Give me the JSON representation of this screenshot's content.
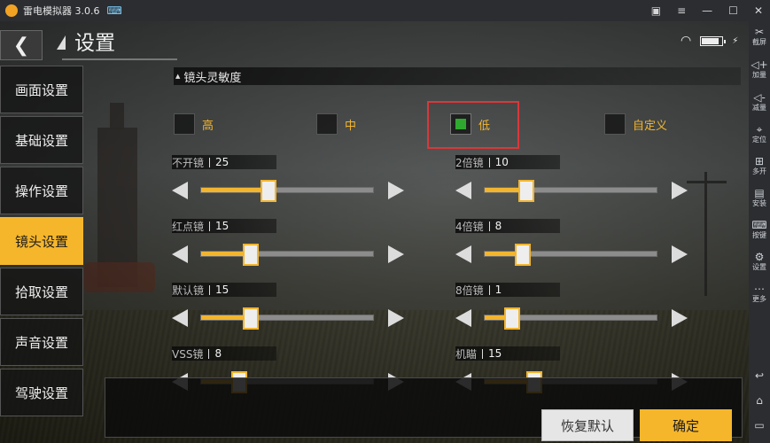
{
  "window": {
    "title": "雷电模拟器 3.0.6"
  },
  "sidebar": {
    "items": [
      {
        "label": "截屏",
        "icon": "scissors-icon"
      },
      {
        "label": "加量",
        "icon": "volume-up-icon"
      },
      {
        "label": "减量",
        "icon": "volume-down-icon"
      },
      {
        "label": "定位",
        "icon": "location-icon"
      },
      {
        "label": "多开",
        "icon": "multi-window-icon"
      },
      {
        "label": "安装",
        "icon": "apk-install-icon"
      },
      {
        "label": "按键",
        "icon": "keyboard-icon"
      },
      {
        "label": "设置",
        "icon": "gear-icon"
      },
      {
        "label": "更多",
        "icon": "more-icon"
      }
    ]
  },
  "header": {
    "title": "设置"
  },
  "status": {
    "battery_level": 0.85
  },
  "tabs": [
    {
      "label": "画面设置",
      "active": false
    },
    {
      "label": "基础设置",
      "active": false
    },
    {
      "label": "操作设置",
      "active": false
    },
    {
      "label": "镜头设置",
      "active": true
    },
    {
      "label": "拾取设置",
      "active": false
    },
    {
      "label": "声音设置",
      "active": false
    },
    {
      "label": "驾驶设置",
      "active": false
    }
  ],
  "section": {
    "title": "镜头灵敏度"
  },
  "sensitivity_options": [
    {
      "label": "高",
      "checked": false
    },
    {
      "label": "中",
      "checked": false
    },
    {
      "label": "低",
      "checked": true
    },
    {
      "label": "自定义",
      "checked": false
    }
  ],
  "sliders": [
    {
      "name": "不开镜",
      "value": "25",
      "fraction": 0.25
    },
    {
      "name": "2倍镜",
      "value": "10",
      "fraction": 0.1
    },
    {
      "name": "红点镜",
      "value": "15",
      "fraction": 0.15
    },
    {
      "name": "4倍镜",
      "value": "8",
      "fraction": 0.08
    },
    {
      "name": "默认镜",
      "value": "15",
      "fraction": 0.15
    },
    {
      "name": "8倍镜",
      "value": "1",
      "fraction": 0.01
    },
    {
      "name": "VSS镜",
      "value": "8",
      "fraction": 0.08
    },
    {
      "name": "机瞄",
      "value": "15",
      "fraction": 0.15
    }
  ],
  "buttons": {
    "restore": "恢复默认",
    "confirm": "确定"
  },
  "colors": {
    "accent": "#f6b62b",
    "checked": "#2fa82f",
    "highlight": "#d9383a"
  }
}
